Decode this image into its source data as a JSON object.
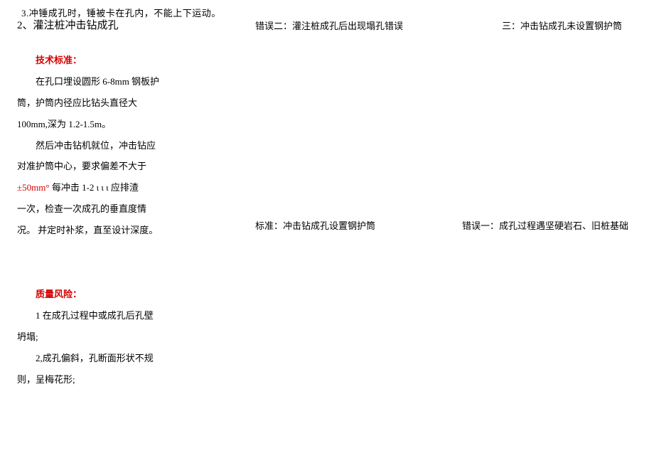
{
  "top": {
    "note": "3.冲锤成孔时，锤被卡在孔内，不能上下运动。",
    "heading": "2、灌注桩冲击钻成孔",
    "cap_mid": "错误二：灌注桩成孔后出现塌孔错误",
    "cap_right": "三：冲击钻成孔未设置钢护筒"
  },
  "tech": {
    "title": "技术标准：",
    "p1a": "在孔口埋设圆形 6-8mm 钢板护",
    "p1b": "筒，护筒内径应比钻头直径大",
    "p1c": "100mm,深为 1.2-1.5m。",
    "p2a": "然后冲击钻机就位，冲击钻应",
    "p2b": "对准护筒中心，要求偏差不大于",
    "p2c_red": "±50mm°",
    "p2c_tail": " 每冲击 1-2 ι ι ι 应排渣",
    "p2d": "一次，检查一次成孔的垂直度情",
    "p2e": "况。 并定时补浆，直至设计深度。"
  },
  "mid": {
    "cap_bottom_mid": "标准：冲击钻成孔设置钢护筒",
    "cap_bottom_right": "错误一：成孔过程遇坚硬岩石、旧桩基础"
  },
  "risk": {
    "title": "质量风险：",
    "r1a": "1 在成孔过程中或成孔后孔壁",
    "r1b": "坍塌;",
    "r2a": "2,成孔偏斜，孔断面形状不规",
    "r2b": "则，呈梅花形;"
  }
}
